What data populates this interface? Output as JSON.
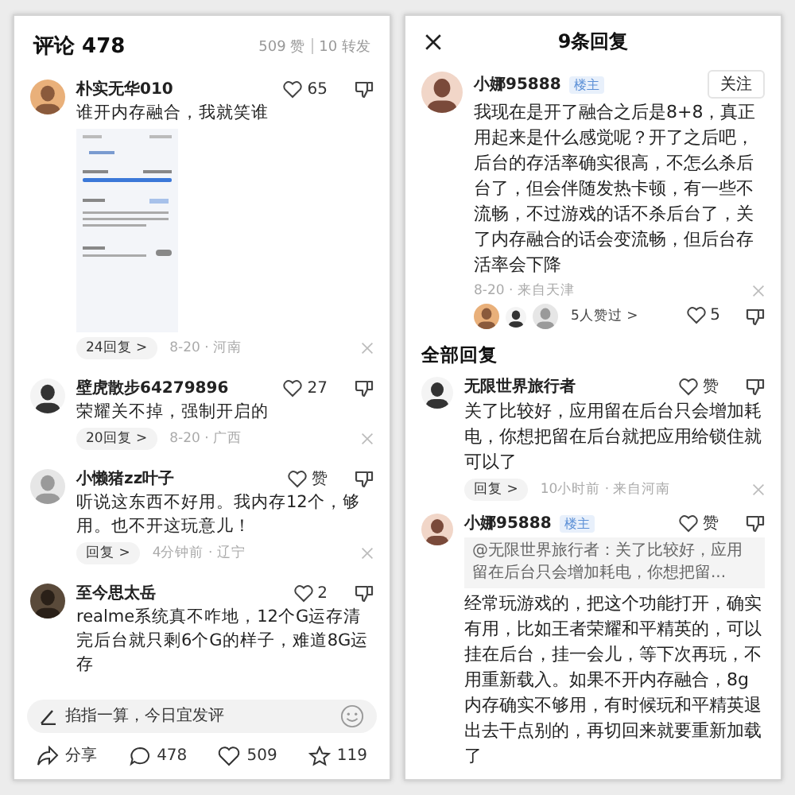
{
  "left_panel": {
    "header": {
      "title": "评论 478",
      "likes": "509 赞",
      "reposts": "10 转发"
    },
    "comments": [
      {
        "user": "朴实无华010",
        "likes": "65",
        "text": "谁开内存融合，我就笑谁",
        "attachment": {
          "kind": "screenshot"
        },
        "replies": "24回复 >",
        "meta": "8-20 · 河南"
      },
      {
        "user": "壁虎散步64279896",
        "likes": "27",
        "text": "荣耀关不掉，强制开启的",
        "replies": "20回复 >",
        "meta": "8-20 · 广西"
      },
      {
        "user": "小懒猪zz叶子",
        "likes": "赞",
        "text": "听说这东西不好用。我内存12个，够用。也不开这玩意儿！",
        "replies": "回复 >",
        "meta": "4分钟前 · 辽宁"
      },
      {
        "user": "至今思太岳",
        "likes": "2",
        "text": "realme系统真不咋地，12个G运存清完后台就只剩6个G的样子，难道8G运存"
      }
    ],
    "input": {
      "placeholder": "掐指一算，今日宜发评"
    },
    "actions": [
      {
        "kind": "share",
        "label": "分享"
      },
      {
        "kind": "comment",
        "label": "478"
      },
      {
        "kind": "like",
        "label": "509"
      },
      {
        "kind": "favorite",
        "label": "119"
      }
    ]
  },
  "right_panel": {
    "title": "9条回复",
    "main_comment": {
      "user": "小娜95888",
      "badge": "楼主",
      "follow": "关注",
      "text": "我现在是开了融合之后是8+8，真正用起来是什么感觉呢？开了之后吧，后台的存活率确实很高，不怎么杀后台了，但会伴随发热卡顿，有一些不流畅，不过游戏的话不杀后台了，关了内存融合的话会变流畅，但后台存活率会下降",
      "meta": "8-20 · 来自天津",
      "likers": "5人赞过 >",
      "likes": "5"
    },
    "section_title": "全部回复",
    "replies": [
      {
        "user": "无限世界旅行者",
        "likes": "赞",
        "text": "关了比较好，应用留在后台只会增加耗电，你想把留在后台就把应用给锁住就可以了",
        "reply": "回复 >",
        "meta": "10小时前 · 来自河南"
      },
      {
        "user": "小娜95888",
        "badge": "楼主",
        "likes": "赞",
        "quote": "@无限世界旅行者：关了比较好，应用留在后台只会增加耗电，你想把留...",
        "text": "经常玩游戏的，把这个功能打开，确实有用，比如王者荣耀和平精英的，可以挂在后台，挂一会儿，等下次再玩，不用重新载入。如果不开内存融合，8g内存确实不够用，有时候玩和平精英退出去干点别的，再切回来就要重新加载了"
      }
    ]
  }
}
